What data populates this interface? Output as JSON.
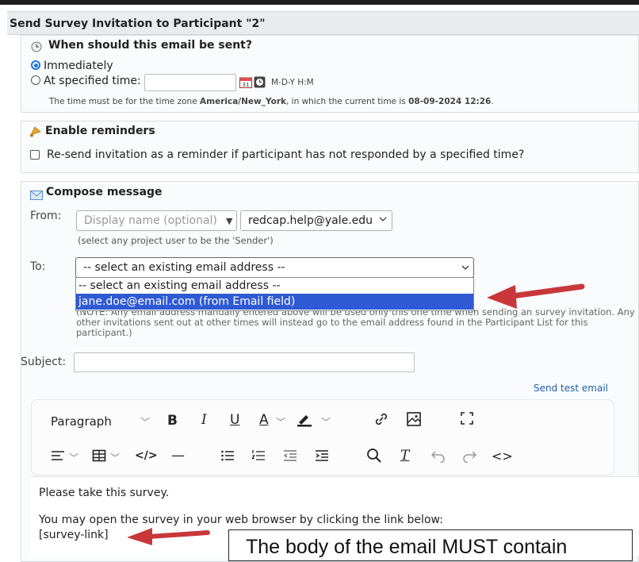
{
  "header": {
    "title": "Send Survey Invitation to Participant \"2\""
  },
  "when": {
    "title": "When should this email be sent?",
    "immediately": "Immediately",
    "specified": "At specified time:",
    "format": "M-D-Y H:M",
    "note_prefix": "The time must be for the time zone ",
    "timezone": "America/New_York",
    "note_mid": ", in which the current time is ",
    "current_time": "08-09-2024 12:26",
    "note_end": ".",
    "calendar_day": "31"
  },
  "reminders": {
    "title": "Enable reminders",
    "checkbox_label": "Re-send invitation as a reminder if participant has not responded by a specified time?"
  },
  "compose": {
    "title": "Compose message",
    "from_label": "From:",
    "display_name_placeholder": "Display name (optional)",
    "from_email": "redcap.help@yale.edu",
    "sender_hint": "(select any project user to be the 'Sender')",
    "to_label": "To:",
    "to_selected": "-- select an existing email address --",
    "to_options": [
      "-- select an existing email address --",
      "jane.doe@email.com (from Email field)"
    ],
    "note_line1": "(NOTE: Any email address manually entered above will be used only this one time when sending an survey invitation. Any",
    "note_line2": "other invitations sent out at other times will instead go to the email address found in the Participant List for this",
    "note_line3": "participant.)",
    "subject_label": "Subject:",
    "send_test": "Send test email"
  },
  "editor": {
    "block_format": "Paragraph",
    "body_line1": "Please take this survey.",
    "body_line2": "You may open the survey in your web browser by clicking the link below:",
    "body_line3": "[survey-link]"
  },
  "callout": {
    "text": "The body of the email MUST contain"
  },
  "colors": {
    "accent": "#1a73e8",
    "selected": "#2f5ad3",
    "arrow": "#c8383b",
    "link": "#1f5fa8"
  }
}
